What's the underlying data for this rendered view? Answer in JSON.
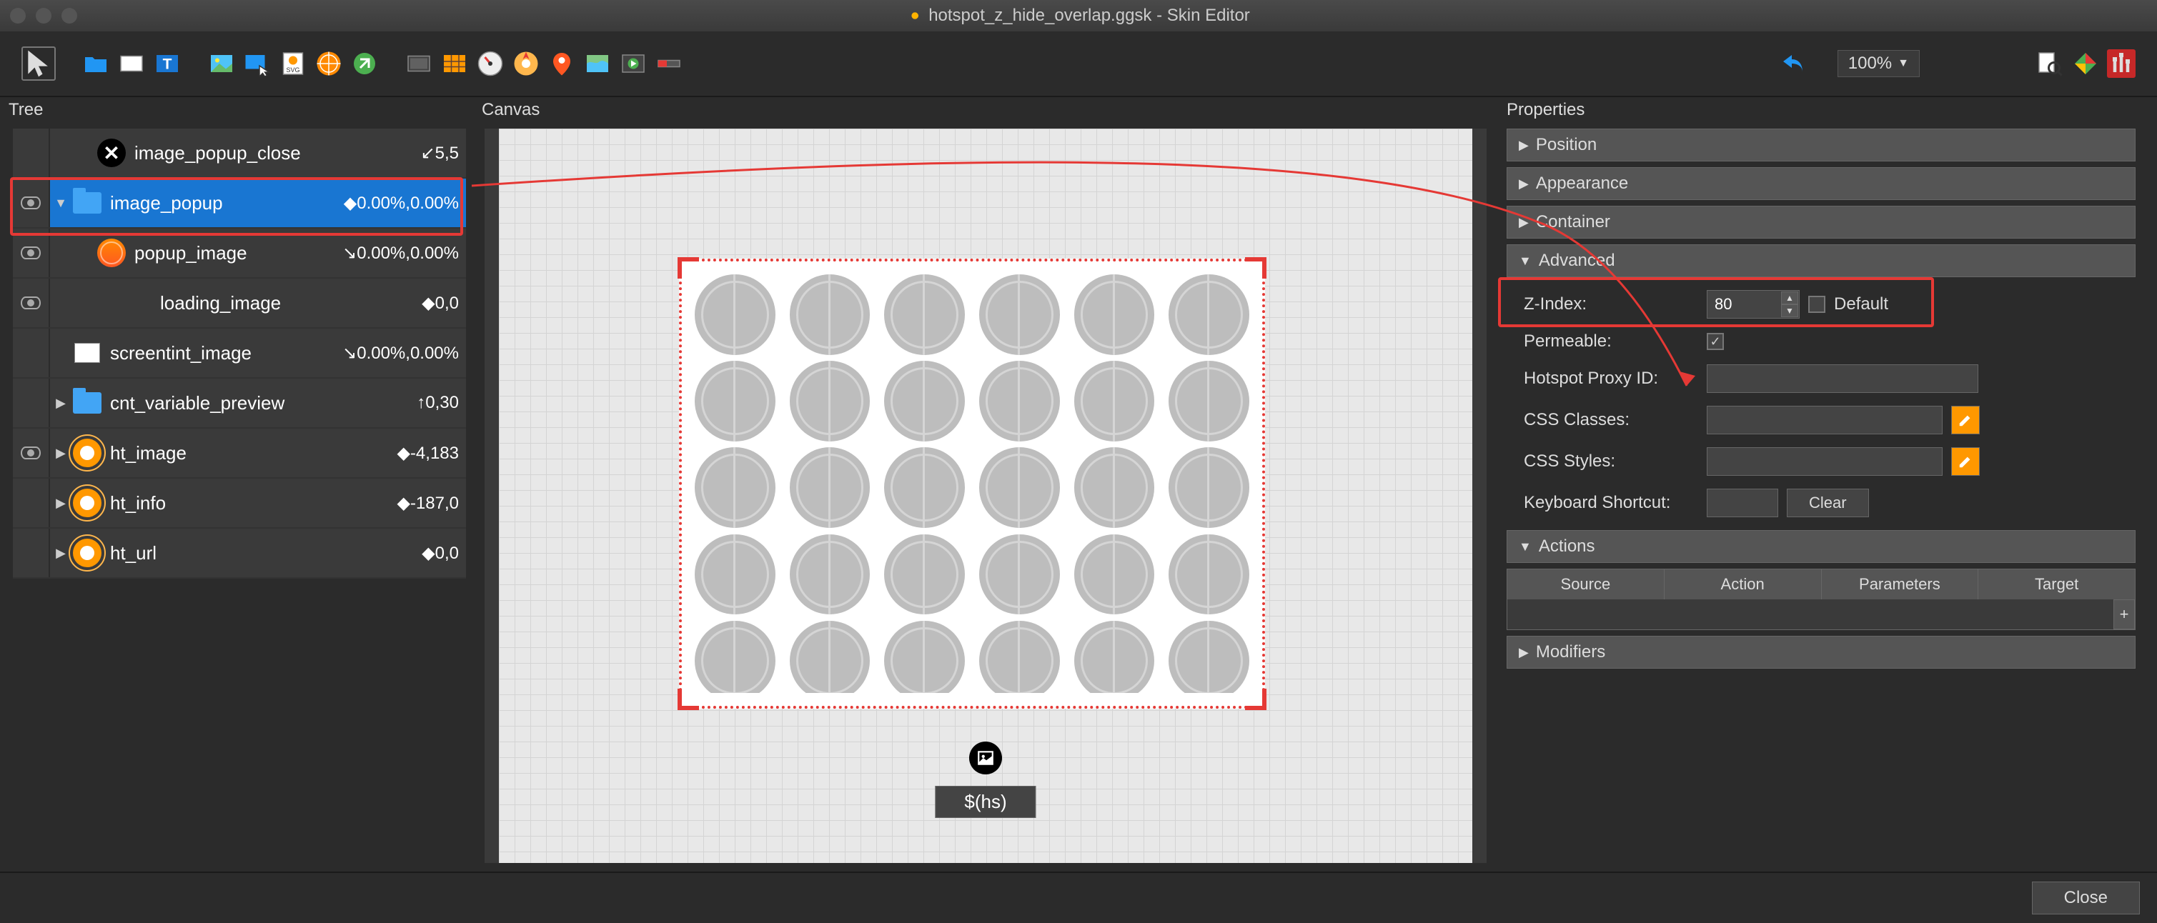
{
  "window": {
    "title": "hotspot_z_hide_overlap.ggsk - Skin Editor"
  },
  "toolbar": {
    "zoom": "100%"
  },
  "panel_headers": {
    "tree": "Tree",
    "canvas": "Canvas",
    "properties": "Properties"
  },
  "tree": {
    "items": [
      {
        "name": "image_popup_close",
        "coord": "↙5,5",
        "icon": "close",
        "indent": 2,
        "expander": "",
        "selected": false,
        "eye": false
      },
      {
        "name": "image_popup",
        "coord": "◆0.00%,0.00%",
        "icon": "folder",
        "indent": 1,
        "expander": "▼",
        "selected": true,
        "eye": true
      },
      {
        "name": "popup_image",
        "coord": "↘0.00%,0.00%",
        "icon": "globe",
        "indent": 2,
        "expander": "",
        "selected": false,
        "eye": true
      },
      {
        "name": "loading_image",
        "coord": "◆0,0",
        "icon": "none",
        "indent": 3,
        "expander": "",
        "selected": false,
        "eye": true
      },
      {
        "name": "screentint_image",
        "coord": "↘0.00%,0.00%",
        "icon": "rect",
        "indent": 1,
        "expander": "",
        "selected": false,
        "eye": false
      },
      {
        "name": "cnt_variable_preview",
        "coord": "↑0,30",
        "icon": "folder",
        "indent": 1,
        "expander": "▶",
        "selected": false,
        "eye": false
      },
      {
        "name": "ht_image",
        "coord": "◆-4,183",
        "icon": "target",
        "indent": 1,
        "expander": "▶",
        "selected": false,
        "eye": true
      },
      {
        "name": "ht_info",
        "coord": "◆-187,0",
        "icon": "target",
        "indent": 1,
        "expander": "▶",
        "selected": false,
        "eye": false
      },
      {
        "name": "ht_url",
        "coord": "◆0,0",
        "icon": "target",
        "indent": 1,
        "expander": "▶",
        "selected": false,
        "eye": false
      }
    ]
  },
  "canvas": {
    "hs_label": "$(hs)"
  },
  "properties": {
    "sections": {
      "position": "Position",
      "appearance": "Appearance",
      "container": "Container",
      "advanced": "Advanced",
      "actions": "Actions",
      "modifiers": "Modifiers"
    },
    "advanced": {
      "z_index_label": "Z-Index:",
      "z_index_value": "80",
      "default_label": "Default",
      "permeable_label": "Permeable:",
      "permeable_checked": true,
      "hotspot_proxy_label": "Hotspot Proxy ID:",
      "css_classes_label": "CSS Classes:",
      "css_styles_label": "CSS Styles:",
      "keyboard_label": "Keyboard Shortcut:",
      "clear_label": "Clear"
    },
    "actions_table": {
      "headers": [
        "Source",
        "Action",
        "Parameters",
        "Target"
      ]
    }
  },
  "footer": {
    "close": "Close"
  },
  "colors": {
    "accent": "#1976d2",
    "highlight": "#e53935",
    "orange": "#ff9800"
  }
}
